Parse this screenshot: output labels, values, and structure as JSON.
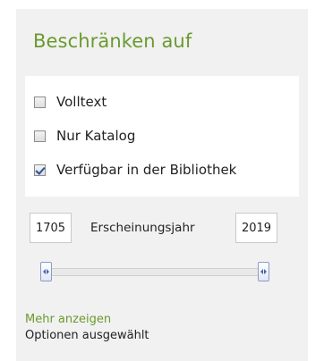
{
  "filter": {
    "title": "Beschränken auf",
    "options": [
      {
        "label": "Volltext",
        "checked": false
      },
      {
        "label": "Nur Katalog",
        "checked": false
      },
      {
        "label": "Verfügbar in der Bibliothek",
        "checked": true
      }
    ],
    "year_range": {
      "from": "1705",
      "label": "Erscheinungsjahr",
      "to": "2019",
      "slider_min_fraction": 0.0,
      "slider_max_fraction": 1.0
    },
    "more_link": "Mehr anzeigen",
    "selected_info": "Optionen ausgewählt"
  },
  "colors": {
    "panel_bg": "#f1f1f1",
    "accent_green": "#6a9a2f",
    "handle_border": "#8a9cc6"
  }
}
